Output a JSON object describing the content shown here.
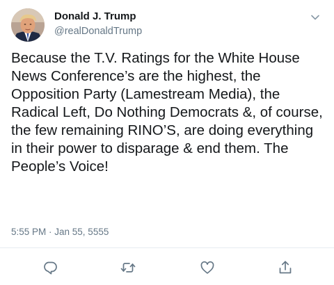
{
  "tweet": {
    "author": {
      "display_name": "Donald J. Trump",
      "handle": "@realDonaldTrump",
      "avatar_icon": "profile-photo"
    },
    "text": "Because the T.V. Ratings for the White House News Conference’s are the highest, the Opposition Party (Lamestream Media), the Radical Left, Do Nothing Democrats &, of course, the few remaining RINO’S, are doing everything in their power to disparage & end them. The People’s Voice!",
    "timestamp": "5:55 PM · Jan 55, 5555",
    "menu_icon": "chevron-down-icon",
    "actions": [
      {
        "name": "reply",
        "icon": "reply-icon"
      },
      {
        "name": "retweet",
        "icon": "retweet-icon"
      },
      {
        "name": "like",
        "icon": "heart-icon"
      },
      {
        "name": "share",
        "icon": "share-icon"
      }
    ]
  },
  "colors": {
    "text_primary": "#14171a",
    "text_secondary": "#657786",
    "divider": "#e6ecf0",
    "icon": "#657786"
  }
}
